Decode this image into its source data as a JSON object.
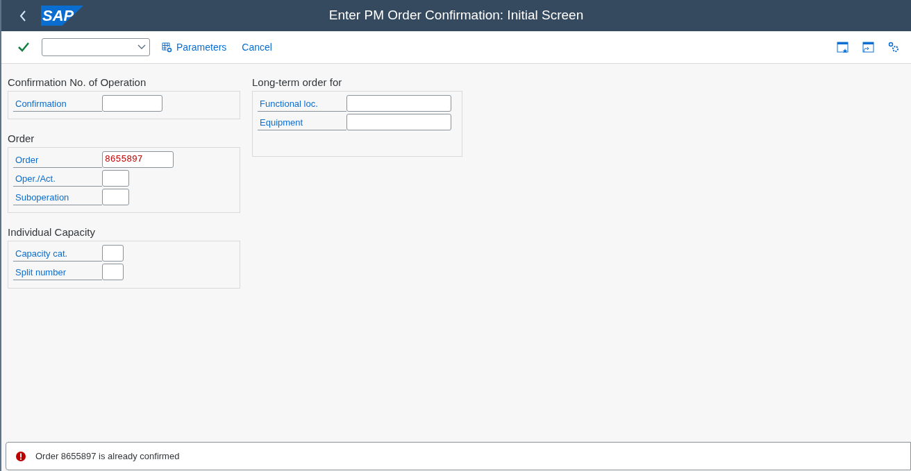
{
  "header": {
    "logo": "SAP",
    "title": "Enter PM Order Confirmation: Initial Screen"
  },
  "toolbar": {
    "buttons": [
      {
        "label": "Parameters"
      },
      {
        "label": "Cancel"
      }
    ]
  },
  "columns": [
    [
      {
        "title": "Confirmation No. of Operation",
        "fields": [
          {
            "label": "Confirmation"
          }
        ]
      },
      {
        "title": "Order",
        "fields": [
          {
            "label": "Order",
            "value": "8655897",
            "error": true
          },
          {
            "label": "Oper./Act."
          },
          {
            "label": "Suboperation"
          }
        ]
      },
      {
        "title": "Individual Capacity",
        "fields": [
          {
            "label": "Capacity cat."
          },
          {
            "label": "Split number"
          }
        ]
      }
    ],
    [
      {
        "title": "Long-term order for",
        "fields": [
          {
            "label": "Functional loc."
          },
          {
            "label": "Equipment"
          }
        ]
      }
    ]
  ],
  "message": {
    "kind": "error",
    "text": "Order 8655897 is already confirmed"
  }
}
